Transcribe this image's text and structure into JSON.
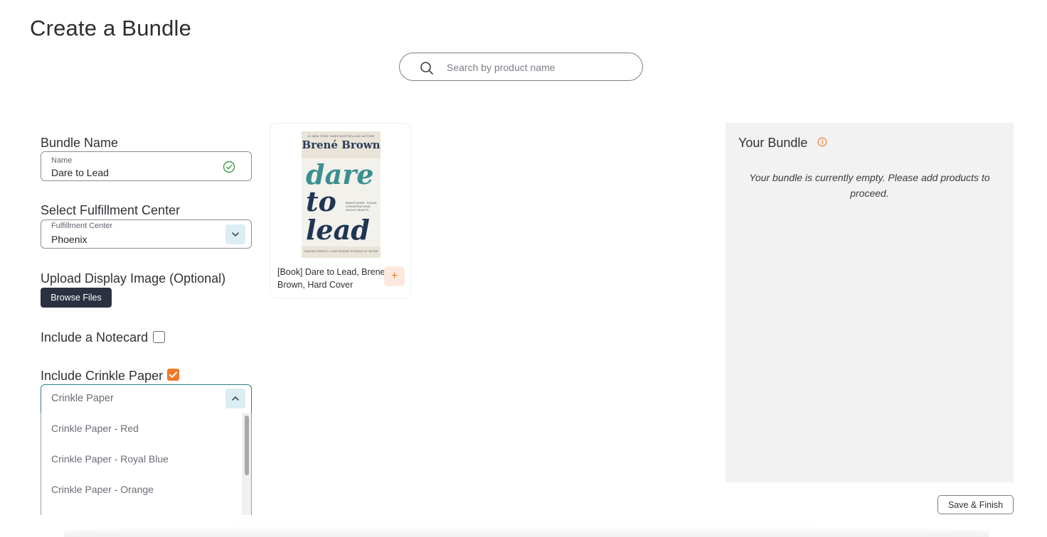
{
  "page": {
    "title": "Create a Bundle"
  },
  "search": {
    "placeholder": "Search by product name",
    "value": ""
  },
  "form": {
    "bundle_name": {
      "section_label": "Bundle Name",
      "field_label": "Name",
      "value": "Dare to Lead"
    },
    "fulfillment": {
      "section_label": "Select Fulfillment Center",
      "field_label": "Fulfillment Center",
      "value": "Phoenix"
    },
    "upload": {
      "section_label": "Upload Display Image (Optional)",
      "button_label": "Browse Files"
    },
    "notecard": {
      "label": "Include a Notecard",
      "checked": false
    },
    "crinkle": {
      "label": "Include Crinkle Paper",
      "checked": true,
      "select_label": "Crinkle Paper",
      "options": [
        "Crinkle Paper - Red",
        "Crinkle Paper - Royal Blue",
        "Crinkle Paper - Orange"
      ]
    }
  },
  "products": [
    {
      "name": "[Book] Dare to Lead, Brene Brown, Hard Cover",
      "add_label": "+",
      "cover": {
        "top_text": "#1 NEW YORK TIMES BESTSELLING AUTHOR",
        "author": "Brené Brown",
        "words": [
          "dare",
          "to",
          "lead"
        ],
        "subtitle": "BRAVE WORK. TOUGH CONVERSATIONS. WHOLE HEARTS.",
        "bottom_text": "DARING GREATLY AND RISING STRONG AT WORK"
      }
    }
  ],
  "bundle": {
    "title": "Your Bundle",
    "empty_message": "Your bundle is currently empty. Please add products to proceed."
  },
  "actions": {
    "save_label": "Save & Finish"
  },
  "colors": {
    "accent_orange": "#f07a2a",
    "dark_button": "#2b3140",
    "chevron_bg": "#dbeef4",
    "valid_green": "#3a9a4a",
    "panel_bg": "#f2f2f2",
    "cover_teal": "#3a8f8f",
    "cover_navy": "#1f3553"
  },
  "icons": {
    "search": "search-icon",
    "valid": "check-circle-icon",
    "chevron_down": "chevron-down-icon",
    "chevron_up": "chevron-up-icon",
    "info": "info-icon",
    "check": "checkmark-icon"
  }
}
